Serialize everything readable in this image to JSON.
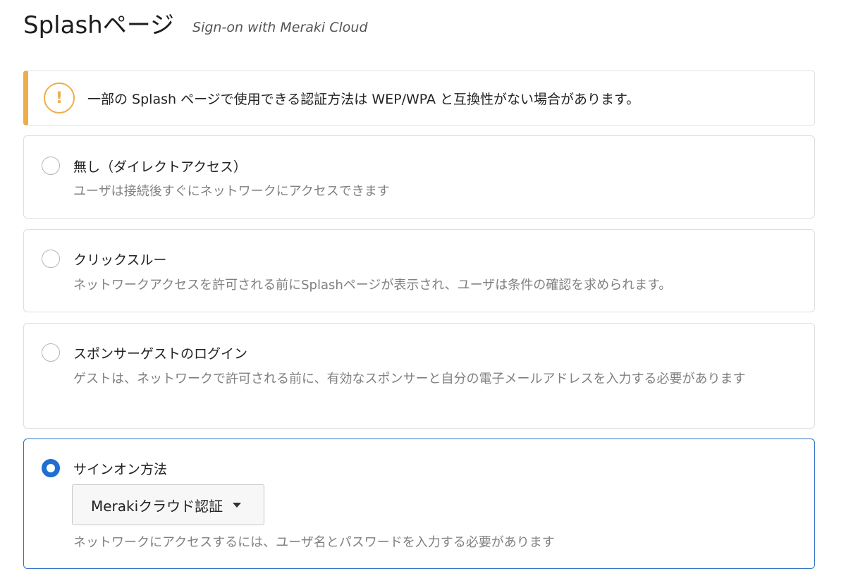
{
  "header": {
    "title": "Splashページ",
    "subtitle": "Sign-on with Meraki Cloud"
  },
  "notice": {
    "icon": "warning-icon",
    "icon_glyph": "!",
    "text": "一部の Splash ページで使用できる認証方法は WEP/WPA と互換性がない場合があります。",
    "accent_color": "#efad4a"
  },
  "options": [
    {
      "title": "無し（ダイレクトアクセス）",
      "description": "ユーザは接続後すぐにネットワークにアクセスできます",
      "selected": false
    },
    {
      "title": "クリックスルー",
      "description": "ネットワークアクセスを許可される前にSplashページが表示され、ユーザは条件の確認を求められます。",
      "selected": false
    },
    {
      "title": "スポンサーゲストのログイン",
      "description": "ゲストは、ネットワークで許可される前に、有効なスポンサーと自分の電子メールアドレスを入力する必要があります",
      "selected": false
    },
    {
      "title": "サインオン方法",
      "description": "ネットワークにアクセスするには、ユーザ名とパスワードを入力する必要があります",
      "selected": true,
      "dropdown": {
        "value": "Merakiクラウド認証",
        "icon": "caret-down-icon"
      }
    }
  ],
  "colors": {
    "selected_border": "#2d70c4",
    "radio_checked": "#1f6fd1",
    "description_text": "#808080"
  }
}
